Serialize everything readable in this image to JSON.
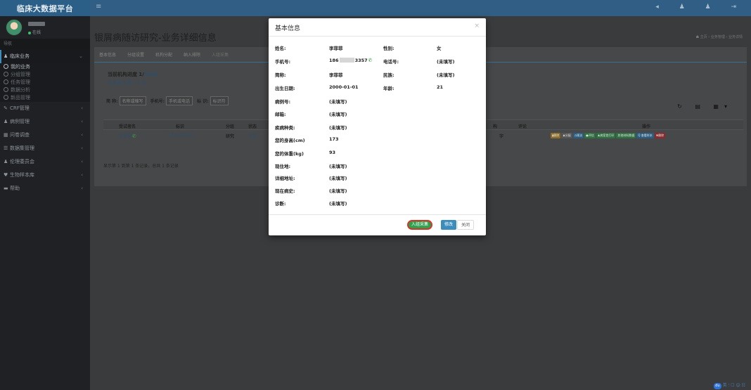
{
  "app": {
    "brand": "临床大数据平台"
  },
  "user": {
    "status": "在线"
  },
  "sidebar": {
    "header": "导航",
    "items": [
      {
        "label": "临床业务",
        "icon": "user-icon",
        "glyph": "♟",
        "active": true,
        "chevron": "⌄"
      },
      {
        "label": "CRF管理",
        "icon": "edit-icon",
        "glyph": "✎",
        "chevron": "‹"
      },
      {
        "label": "病例管理",
        "icon": "users-icon",
        "glyph": "♟",
        "chevron": "‹"
      },
      {
        "label": "问卷调查",
        "icon": "grid-icon",
        "glyph": "▦",
        "chevron": "‹"
      },
      {
        "label": "数据集管理",
        "icon": "list-icon",
        "glyph": "☰",
        "chevron": "‹"
      },
      {
        "label": "伦理委员会",
        "icon": "committee-icon",
        "glyph": "♟",
        "chevron": "‹"
      },
      {
        "label": "生物样本库",
        "icon": "heart-icon",
        "glyph": "♥",
        "chevron": "‹"
      },
      {
        "label": "帮助",
        "icon": "folder-icon",
        "glyph": "▬",
        "chevron": "‹"
      }
    ],
    "subitems": [
      "我的业务",
      "分组管理",
      "任务管理",
      "数据分析",
      "新品管理"
    ]
  },
  "topbar": {
    "menu_glyph": "≡",
    "icons": [
      "bell-icon",
      "user-icon",
      "users-icon",
      "logout-icon"
    ],
    "icon_glyphs": "◂ ♟ ♟ ⇥"
  },
  "page": {
    "title": "银屑病随访研究-业务详细信息",
    "breadcrumb": "☗ 主页 › 业务管理 › 业务详情"
  },
  "tabs": [
    "基本信息",
    "分组设置",
    "机构分配",
    "纳入排除",
    "入组采集"
  ],
  "summary": {
    "progress_label": "当前机构进度 1/",
    "progress_total": "1050",
    "visits": "访视期人数：1 位"
  },
  "filters": {
    "name_label": "简  称:",
    "name_placeholder": "名称或缩写",
    "phone_label": "手机号:",
    "phone_placeholder": "手机或电话",
    "tag_label": "标  识:",
    "tag_placeholder": "标识符"
  },
  "toolbar_glyphs": "↻ ▤ ▦▾",
  "table": {
    "headers": [
      "受试者名",
      "标识",
      "分组",
      "状态",
      "构",
      "评论",
      "操作"
    ],
    "row": {
      "name": "李菲菲",
      "id": "1424-00161",
      "group": "研究",
      "status": "正常",
      "inst": "字"
    },
    "op_buttons": [
      {
        "label": "▮删除",
        "color": "#8a6d26"
      },
      {
        "label": "♟分配",
        "color": "#555555"
      },
      {
        "label": "◷随访",
        "color": "#2b5d80"
      },
      {
        "label": "●评估",
        "color": "#2e7040"
      },
      {
        "label": "♟病案首打印",
        "color": "#2e7040"
      },
      {
        "label": "其他材料数据",
        "color": "#2e7040"
      },
      {
        "label": "Q 查看样本",
        "color": "#2b5d80"
      },
      {
        "label": "✖删除",
        "color": "#8a2a2a"
      }
    ],
    "page_info": "显示第 1 到第 1 条记录，总共 1 条记录"
  },
  "modal": {
    "title": "基本信息",
    "close": "×",
    "fields": [
      {
        "label": "姓名:",
        "value": "李菲菲",
        "label2": "性别:",
        "value2": "女"
      },
      {
        "label": "手机号:",
        "value_prefix": "186",
        "value_suffix": "3357",
        "label2": "电话号:",
        "value2": "(未填写)"
      },
      {
        "label": "简称:",
        "value": "李菲菲",
        "label2": "民族:",
        "value2": "(未填写)"
      },
      {
        "label": "出生日期:",
        "value": "2000-01-01",
        "label2": "年龄:",
        "value2": "21"
      },
      {
        "label": "病例号:",
        "value": "(未填写)"
      },
      {
        "label": "邮箱:",
        "value": "(未填写)"
      },
      {
        "label": "疾病种类:",
        "value": "(未填写)"
      },
      {
        "label": "您的身高(cm)",
        "value": "173"
      },
      {
        "label": "您的体重(kg)",
        "value": "93"
      },
      {
        "label": "现住地:",
        "value": "(未填写)"
      },
      {
        "label": "详细地址:",
        "value": "(未填写)"
      },
      {
        "label": "现在病史:",
        "value": "(未填写)"
      },
      {
        "label": "诊断:",
        "value": "(未填写)"
      }
    ],
    "buttons": {
      "enroll": "入组采集",
      "edit": "修改",
      "close": "关闭"
    }
  },
  "ime": {
    "logo": "du",
    "glyphs": "英 ⸵ ☐ ☺ ☷"
  }
}
